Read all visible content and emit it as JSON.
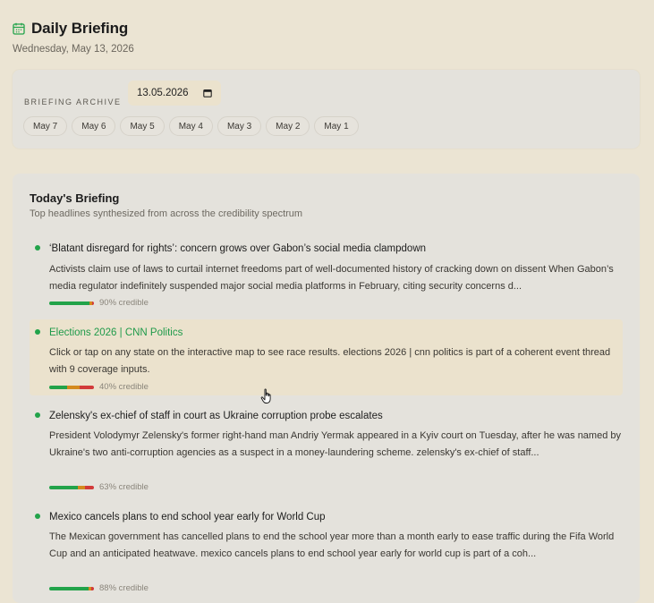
{
  "header": {
    "title": "Daily Briefing",
    "date": "Wednesday, May 13, 2026"
  },
  "archive": {
    "label": "BRIEFING ARCHIVE",
    "date_value": "13.05.2026",
    "chips": [
      "May 7",
      "May 6",
      "May 5",
      "May 4",
      "May 3",
      "May 2",
      "May 1"
    ]
  },
  "briefing": {
    "title": "Today's Briefing",
    "subtitle": "Top headlines synthesized from across the credibility spectrum",
    "items": [
      {
        "headline": "‘Blatant disregard for rights’: concern grows over Gabon’s social media clampdown",
        "summary": "Activists claim use of laws to curtail internet freedoms part of well-documented history of cracking down on dissent When Gabon’s media regulator indefinitely suspended major social media platforms in February, citing security concerns d...",
        "credibility": "90% credible",
        "credibility_value": 0.9
      },
      {
        "headline": "Elections 2026 | CNN Politics",
        "summary": "Click or tap on any state on the interactive map to see race results. elections 2026 | cnn politics is part of a coherent event thread with 9 coverage inputs.",
        "credibility": "40% credible",
        "credibility_value": 0.4
      },
      {
        "headline": "Zelensky's ex-chief of staff in court as Ukraine corruption probe escalates",
        "summary": "President Volodymyr Zelensky's former right-hand man Andriy Yermak appeared in a Kyiv court on Tuesday, after he was named by Ukraine's two anti-corruption agencies as a suspect in a money-laundering scheme. zelensky's ex-chief of staff...",
        "credibility": "63% credible",
        "credibility_value": 0.63
      },
      {
        "headline": "Mexico cancels plans to end school year early for World Cup",
        "summary": "The Mexican government has cancelled plans to end the school year more than a month early to ease traffic during the Fifa World Cup and an anticipated heatwave. mexico cancels plans to end school year early for world cup is part of a coh...",
        "credibility": "88% credible",
        "credibility_value": 0.88
      }
    ]
  },
  "colors": {
    "accent_green": "#22a34a",
    "link_green": "#1f9a4a",
    "bar_orange": "#d48a1e",
    "bar_red": "#d23a3a",
    "page_bg": "#ebe4d3",
    "card_bg": "#e4e2dc"
  },
  "icons": {
    "header": "calendar-icon",
    "date_input": "calendar-picker-icon",
    "cursor": "hand-pointer-icon"
  }
}
